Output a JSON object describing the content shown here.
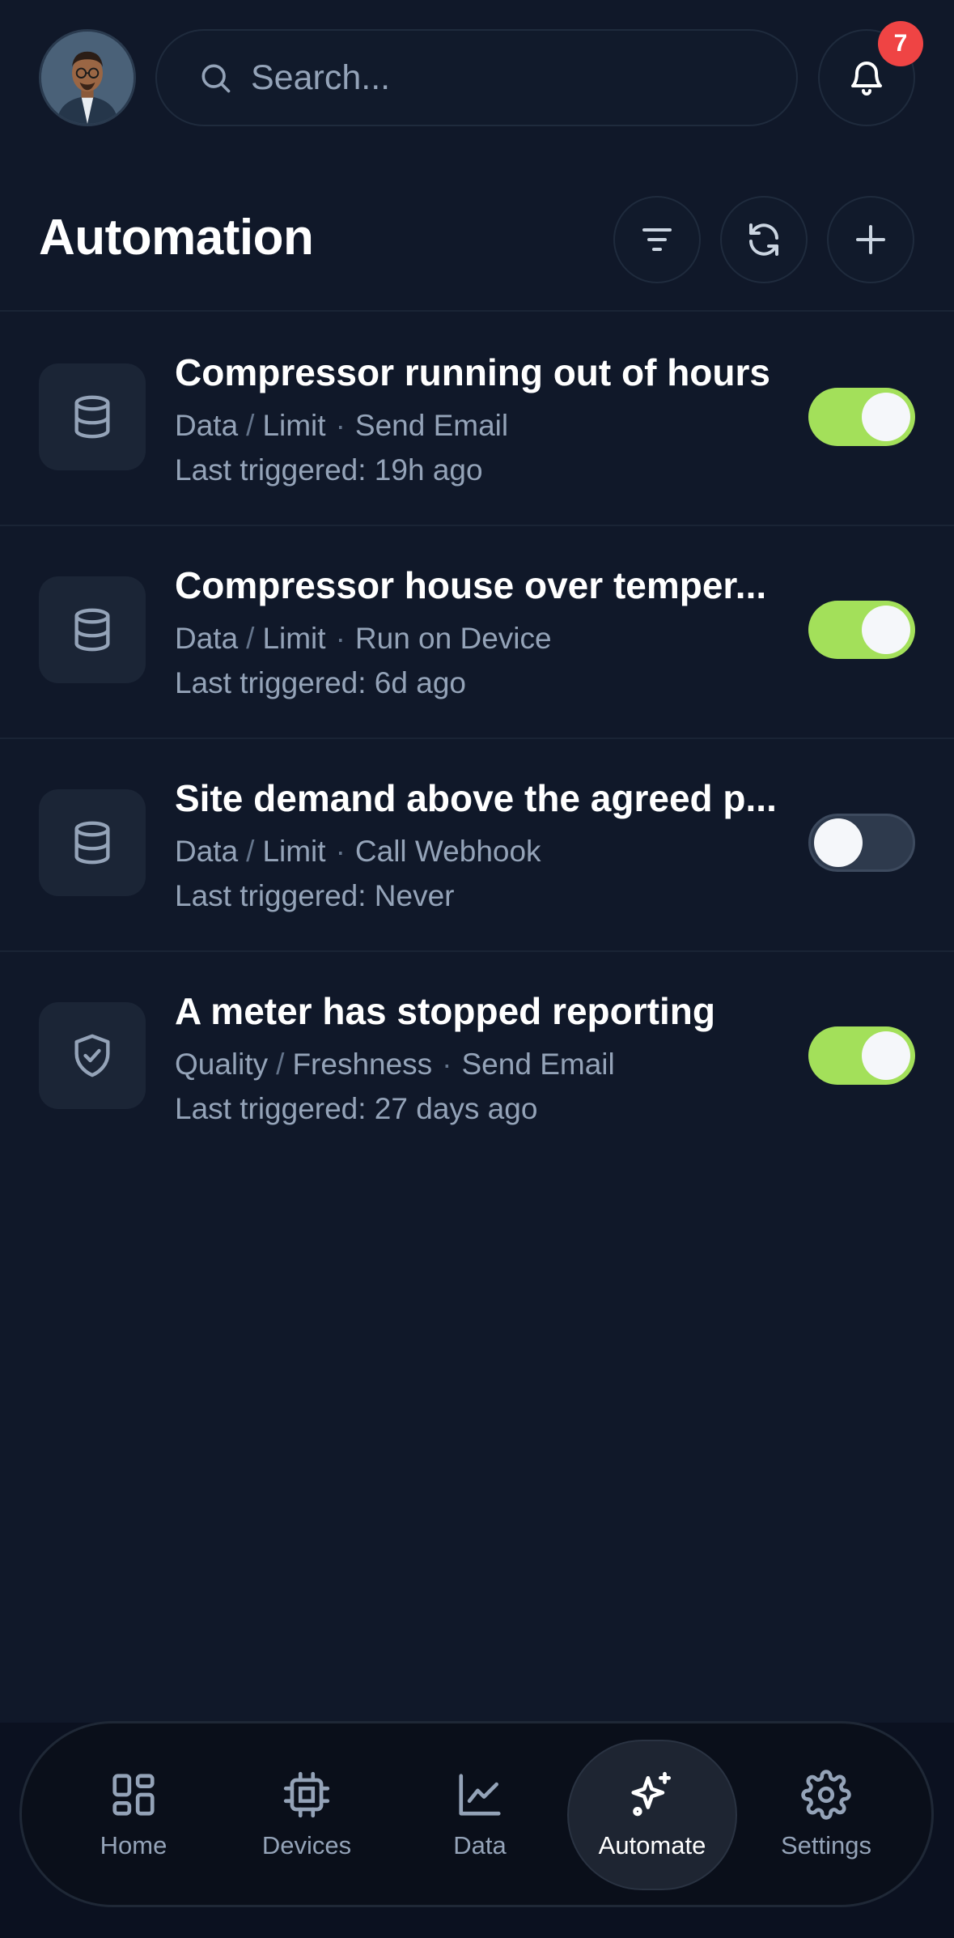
{
  "search": {
    "placeholder": "Search..."
  },
  "notifications": {
    "count": "7"
  },
  "header": {
    "title": "Automation"
  },
  "automations": [
    {
      "icon": "database-icon",
      "title": "Compressor running out of hours",
      "source": "Data",
      "type": "Limit",
      "action": "Send Email",
      "last": "Last triggered: 19h ago",
      "enabled": true
    },
    {
      "icon": "database-icon",
      "title": "Compressor house over temper...",
      "source": "Data",
      "type": "Limit",
      "action": "Run on Device",
      "last": "Last triggered: 6d ago",
      "enabled": true
    },
    {
      "icon": "database-icon",
      "title": "Site demand above the agreed p...",
      "source": "Data",
      "type": "Limit",
      "action": "Call Webhook",
      "last": "Last triggered: Never",
      "enabled": false
    },
    {
      "icon": "shield-check-icon",
      "title": "A meter has stopped reporting",
      "source": "Quality",
      "type": "Freshness",
      "action": "Send Email",
      "last": "Last triggered: 27 days ago",
      "enabled": true
    }
  ],
  "nav": {
    "items": [
      {
        "label": "Home",
        "icon": "grid-icon"
      },
      {
        "label": "Devices",
        "icon": "chip-icon"
      },
      {
        "label": "Data",
        "icon": "line-chart-icon"
      },
      {
        "label": "Automate",
        "icon": "sparkles-icon",
        "active": true
      },
      {
        "label": "Settings",
        "icon": "gear-icon"
      }
    ]
  },
  "colors": {
    "background": "#101829",
    "accent_toggle": "#a3e05a",
    "badge": "#ef4444",
    "muted_text": "#94a3b8"
  }
}
